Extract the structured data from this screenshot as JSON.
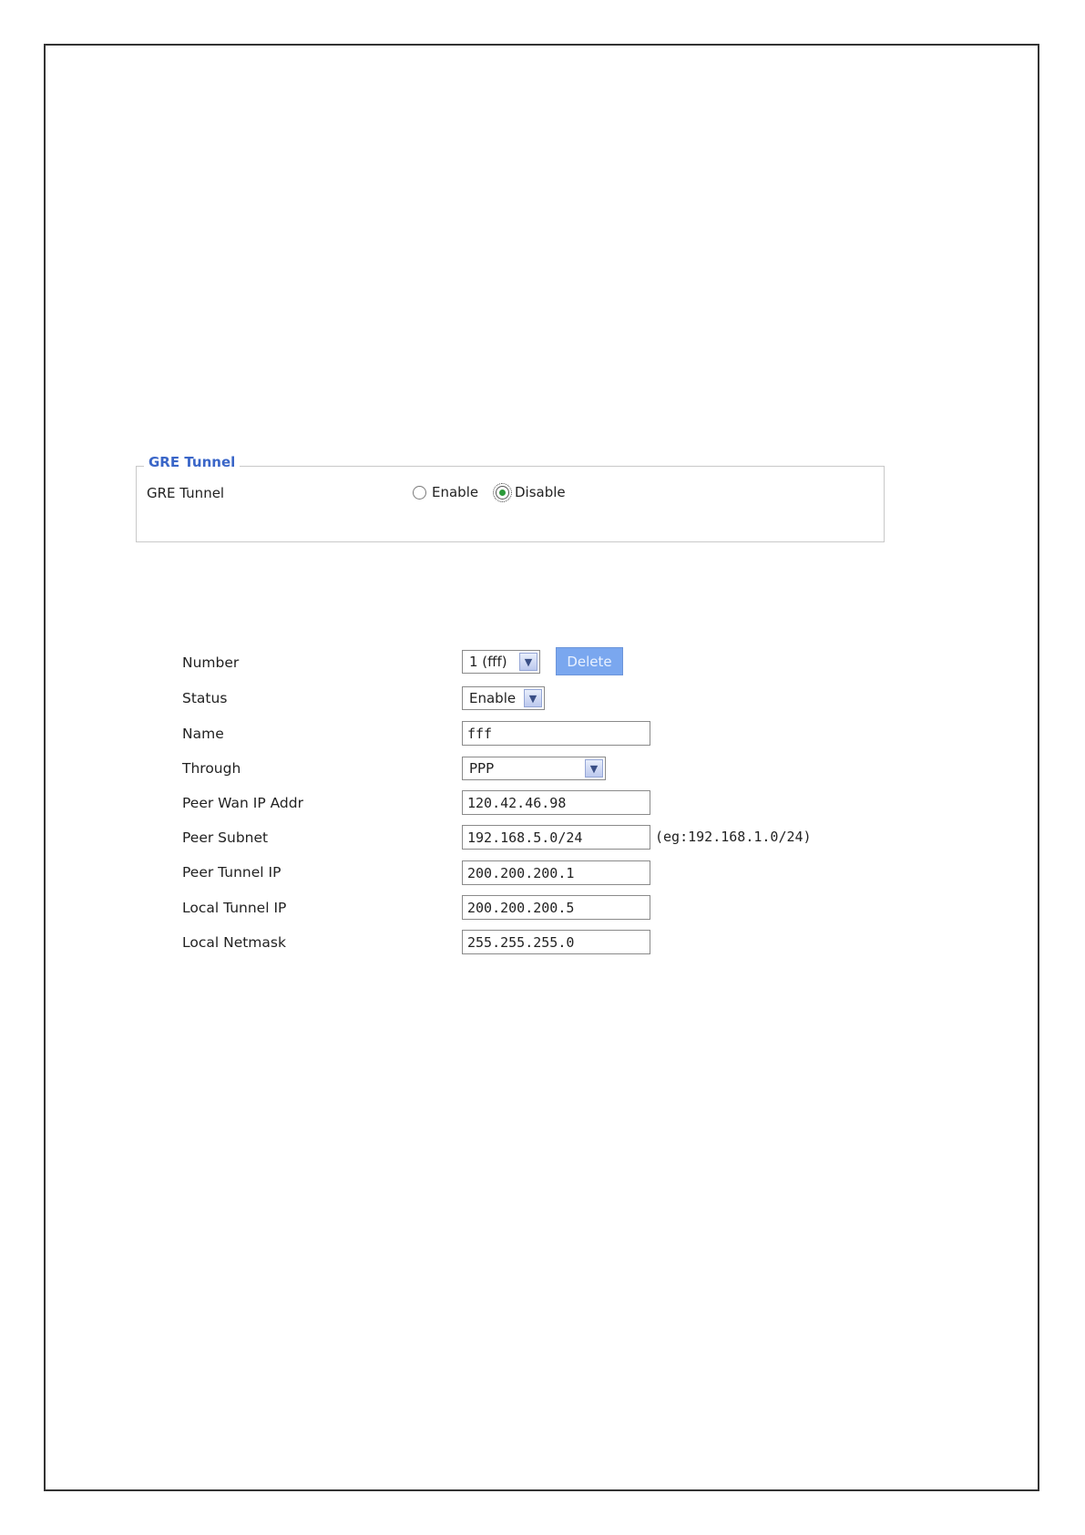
{
  "gre_section": {
    "legend": "GRE Tunnel",
    "label": "GRE Tunnel",
    "options": [
      {
        "label": "Enable",
        "checked": false
      },
      {
        "label": "Disable",
        "checked": true
      }
    ]
  },
  "form": {
    "number": {
      "label": "Number",
      "value": "1 (fff)"
    },
    "delete_button": "Delete",
    "status": {
      "label": "Status",
      "value": "Enable"
    },
    "name": {
      "label": "Name",
      "value": "fff"
    },
    "through": {
      "label": "Through",
      "value": "PPP"
    },
    "peer_wan_ip": {
      "label": "Peer Wan IP Addr",
      "value": "120.42.46.98"
    },
    "peer_subnet": {
      "label": "Peer Subnet",
      "value": "192.168.5.0/24",
      "hint": "(eg:192.168.1.0/24)"
    },
    "peer_tunnel_ip": {
      "label": "Peer Tunnel IP",
      "value": "200.200.200.1"
    },
    "local_tunnel_ip": {
      "label": "Local Tunnel IP",
      "value": "200.200.200.5"
    },
    "local_netmask": {
      "label": "Local Netmask",
      "value": "255.255.255.0"
    }
  }
}
